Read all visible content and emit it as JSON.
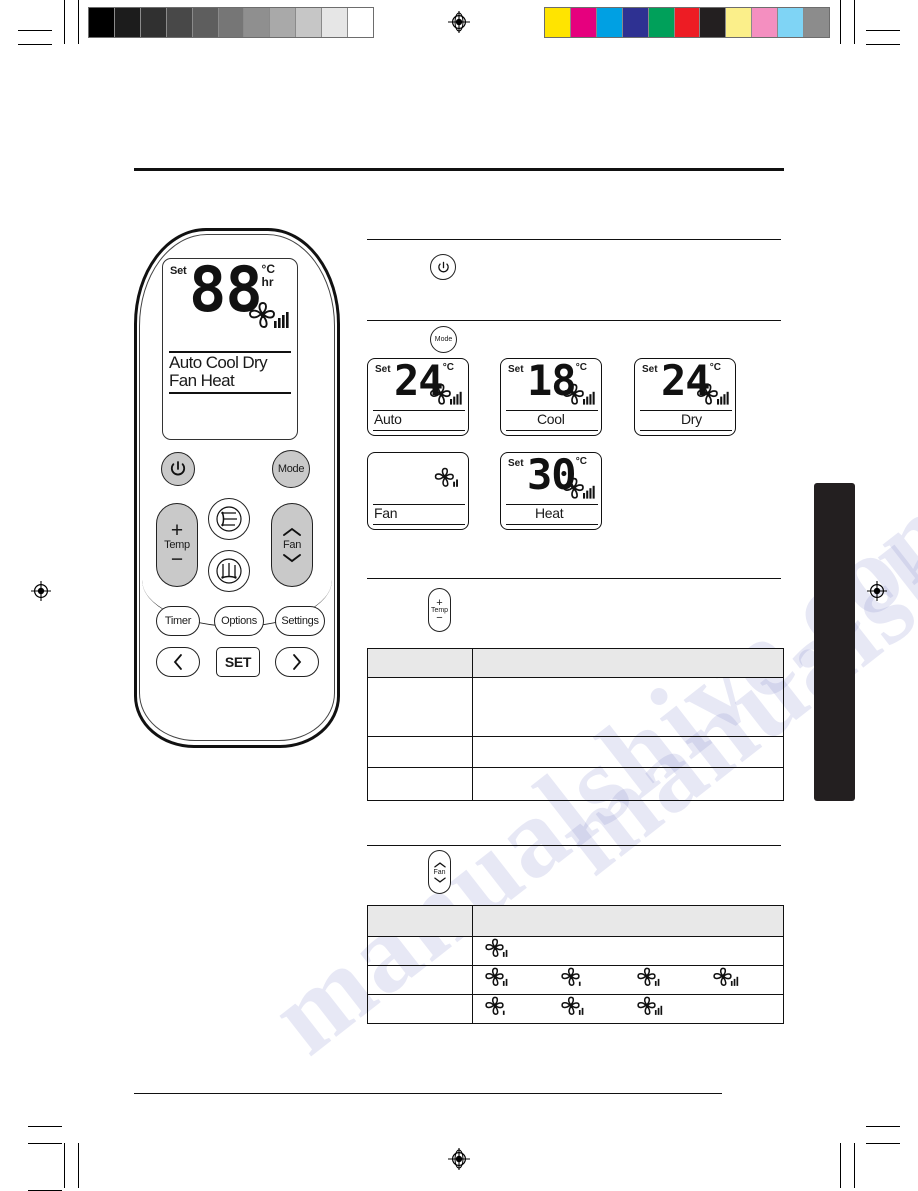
{
  "printer_marks": {
    "grayscale_patches": [
      "#000000",
      "#1c1c1c",
      "#303030",
      "#484848",
      "#5e5e5e",
      "#767676",
      "#8f8f8f",
      "#a9a9a9",
      "#c6c6c6",
      "#e6e6e6",
      "#ffffff"
    ],
    "color_patches": [
      "#ffe400",
      "#e6007e",
      "#00a0e3",
      "#2e3192",
      "#00a05a",
      "#ed1c24",
      "#231f20",
      "#fbef8a",
      "#f happened",
      "#7fd4f5",
      "#8c8c8c"
    ],
    "color_patches_fixed": [
      "#ffe400",
      "#e6007e",
      "#00a0e3",
      "#2e3192",
      "#00a05a",
      "#ed1c24",
      "#231f20",
      "#fbef8a",
      "#f48fc0",
      "#7fd4f5",
      "#8c8c8c"
    ],
    "registration_icon": "registration-target-icon"
  },
  "remote": {
    "lcd": {
      "set_label": "Set",
      "digits": "88",
      "unit_c": "°C",
      "unit_hr": "hr",
      "fan_icon": "fan-blade-icon",
      "mode_row_1": "Auto Cool Dry",
      "mode_row_2": "Fan   Heat"
    },
    "buttons": {
      "power": "power-icon",
      "mode": "Mode",
      "temp": "Temp",
      "temp_up": "+",
      "temp_down": "−",
      "fan": "Fan",
      "fan_up": "chevron-up-icon",
      "fan_down": "chevron-down-icon",
      "swing_vertical": "air-swing-vertical-icon",
      "swing_horizontal": "air-swing-horizontal-icon",
      "timer": "Timer",
      "options": "Options",
      "settings": "Settings",
      "prev": "<",
      "set": "SET",
      "next": ">"
    }
  },
  "sections": [
    {
      "id": "power-section",
      "button_icon": "power-icon",
      "button_label": ""
    },
    {
      "id": "mode-section",
      "button_label": "Mode",
      "panels": [
        {
          "set_label": "Set",
          "value": "24",
          "unit": "°C",
          "fan_icon": "fan-blade-icon",
          "fan_bars": 4,
          "mode": "Auto"
        },
        {
          "set_label": "Set",
          "value": "18",
          "unit": "°C",
          "fan_icon": "fan-blade-icon",
          "fan_bars": 4,
          "mode": "Cool"
        },
        {
          "set_label": "Set",
          "value": "24",
          "unit": "°C",
          "fan_icon": "fan-blade-icon",
          "fan_bars": 4,
          "mode": "Dry"
        },
        {
          "set_label": "",
          "value": "",
          "unit": "",
          "fan_icon": "fan-blade-icon",
          "fan_bars": 2,
          "mode": "Fan"
        },
        {
          "set_label": "Set",
          "value": "30",
          "unit": "°C",
          "fan_icon": "fan-blade-icon",
          "fan_bars": 4,
          "mode": "Heat"
        }
      ]
    },
    {
      "id": "temp-section",
      "button_label": "Temp",
      "button_plus": "+",
      "button_minus": "−",
      "table": {
        "headers": [
          "",
          ""
        ],
        "rows": [
          [
            "",
            ""
          ],
          [
            "",
            ""
          ],
          [
            "",
            ""
          ]
        ]
      }
    },
    {
      "id": "fan-section",
      "button_label": "Fan",
      "button_up": "chevron-up-icon",
      "button_down": "chevron-down-icon",
      "table": {
        "headers": [
          "",
          ""
        ],
        "rows": [
          {
            "label": "",
            "fans": [
              2
            ]
          },
          {
            "label": "",
            "fans": [
              2,
              1,
              2,
              3
            ]
          },
          {
            "label": "",
            "fans": [
              1,
              2,
              3
            ]
          }
        ]
      }
    }
  ],
  "watermarks": [
    "manualshive.com",
    "manualshive.com"
  ]
}
